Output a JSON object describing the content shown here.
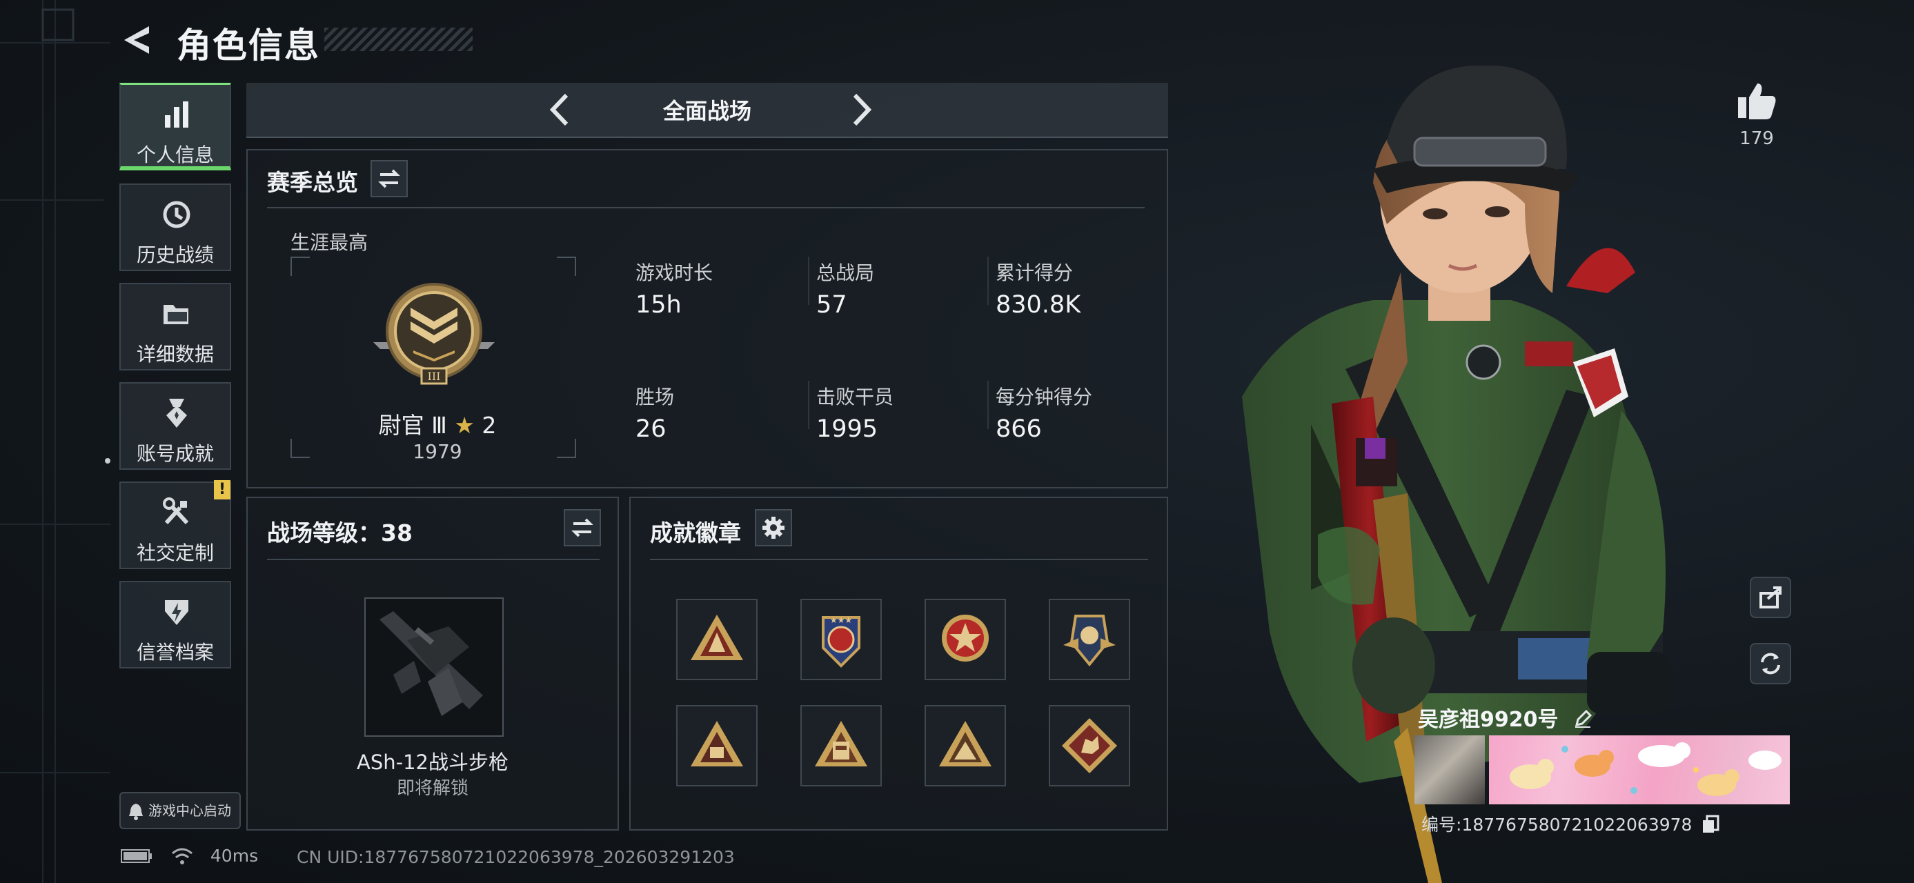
{
  "header": {
    "title": "角色信息"
  },
  "sidebar": {
    "items": [
      {
        "label": "个人信息",
        "icon": "bar-chart-icon",
        "active": true
      },
      {
        "label": "历史战绩",
        "icon": "history-clock-icon"
      },
      {
        "label": "详细数据",
        "icon": "folder-icon"
      },
      {
        "label": "账号成就",
        "icon": "medal-icon"
      },
      {
        "label": "社交定制",
        "icon": "tools-icon",
        "badge": "!"
      },
      {
        "label": "信誉档案",
        "icon": "shield-bolt-icon"
      }
    ],
    "launch_label": "游戏中心启动"
  },
  "mode_bar": {
    "label": "全面战场"
  },
  "season": {
    "title": "赛季总览",
    "career_label": "生涯最高",
    "rank_name": "尉官 Ⅲ",
    "rank_stars": "2",
    "rank_score": "1979",
    "stats": [
      {
        "label": "游戏时长",
        "value": "15h"
      },
      {
        "label": "总战局",
        "value": "57"
      },
      {
        "label": "累计得分",
        "value": "830.8K"
      },
      {
        "label": "胜场",
        "value": "26"
      },
      {
        "label": "击败干员",
        "value": "1995"
      },
      {
        "label": "每分钟得分",
        "value": "866"
      }
    ]
  },
  "battle_level": {
    "title": "战场等级：38",
    "weapon_name": "ASh-12战斗步枪",
    "weapon_status": "即将解锁"
  },
  "achievements": {
    "title": "成就徽章",
    "badges": [
      "triangle-badge-1",
      "star-crest-badge",
      "red-star-badge",
      "wings-badge",
      "triangle-badge-2",
      "triangle-badge-3",
      "triangle-badge-4",
      "beast-diamond-badge"
    ]
  },
  "profile": {
    "likes": "179",
    "name": "吴彦祖9920号",
    "uid_line": "编号:18776758072102206397​8"
  },
  "status_bar": {
    "ping": "40ms",
    "cn_uid": "CN UID:18776758072102206397​8_202603291203"
  },
  "colors": {
    "accent_green": "#6cd86c",
    "badge_gold": "#c9a25a",
    "alert_yellow": "#e8c44b"
  }
}
